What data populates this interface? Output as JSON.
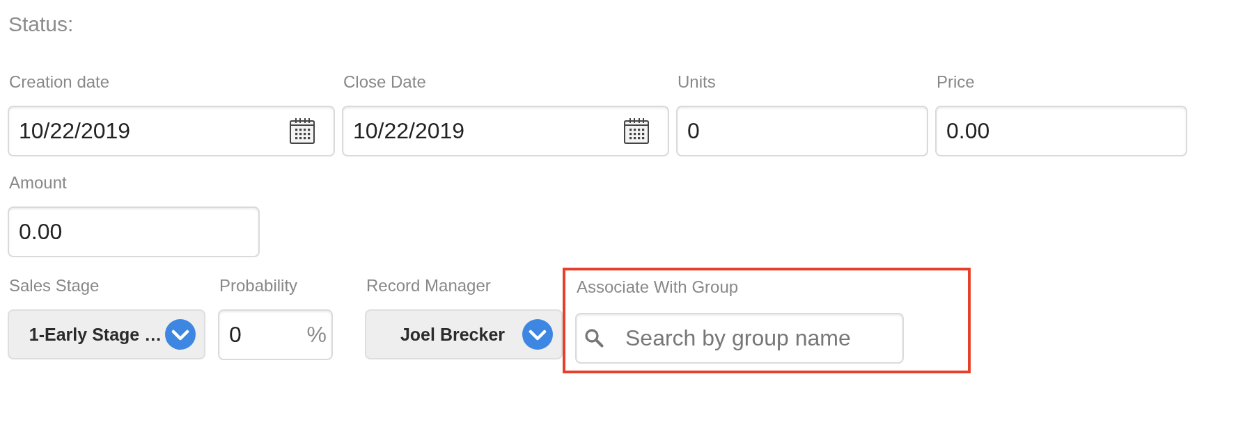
{
  "status": {
    "label": "Status:"
  },
  "form": {
    "rows": [
      {
        "fields": [
          {
            "kind": "date",
            "label": "Creation date",
            "value": "10/22/2019",
            "highlighted": false
          },
          {
            "kind": "date",
            "label": "Close Date",
            "value": "10/22/2019",
            "highlighted": false
          },
          {
            "kind": "number",
            "label": "Units",
            "value": "0",
            "highlighted": false
          },
          {
            "kind": "number",
            "label": "Price",
            "value": "0.00",
            "highlighted": false
          }
        ]
      },
      {
        "fields": [
          {
            "kind": "number",
            "label": "Amount",
            "value": "0.00",
            "highlighted": false
          }
        ]
      },
      {
        "fields": [
          {
            "kind": "select",
            "label": "Sales Stage",
            "value": "1-Early Stage …",
            "highlighted": false
          },
          {
            "kind": "percent",
            "label": "Probability",
            "value": "0",
            "suffix": "%",
            "highlighted": false
          },
          {
            "kind": "select",
            "label": "Record Manager",
            "value": "Joel Brecker",
            "highlighted": false
          },
          {
            "kind": "search",
            "label": "Associate With Group",
            "placeholder": "Search by group name",
            "highlighted": true
          }
        ]
      }
    ]
  }
}
